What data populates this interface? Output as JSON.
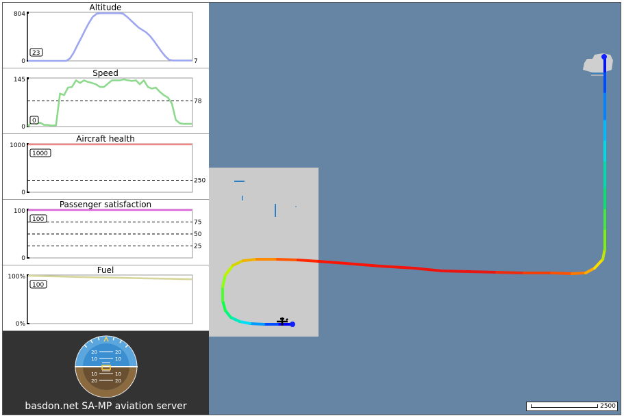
{
  "panels": [
    {
      "title": "Altitude",
      "ymax_label": "804",
      "ymin_label": "0",
      "right_label": "7",
      "badge": "23",
      "color": "#9da6f0",
      "ymax": 804,
      "refs": [],
      "values": [
        0,
        0,
        0,
        0,
        0,
        0,
        0,
        0,
        0,
        0,
        0,
        40,
        140,
        270,
        390,
        520,
        640,
        740,
        790,
        800,
        800,
        800,
        800,
        800,
        800,
        790,
        740,
        680,
        620,
        560,
        520,
        480,
        420,
        340,
        250,
        160,
        80,
        20,
        7,
        7,
        7,
        7,
        7,
        7
      ]
    },
    {
      "title": "Speed",
      "ymax_label": "145",
      "ymin_label": "0",
      "badge": "0",
      "color": "#8fd98f",
      "ymax": 145,
      "refs": [
        {
          "v": 78,
          "label": "78"
        }
      ],
      "values": [
        0,
        18,
        8,
        12,
        5,
        5,
        3,
        4,
        100,
        95,
        118,
        120,
        140,
        132,
        140,
        135,
        132,
        128,
        120,
        120,
        130,
        140,
        140,
        140,
        143,
        140,
        138,
        140,
        128,
        140,
        120,
        115,
        118,
        105,
        95,
        88,
        70,
        20,
        10,
        8,
        8,
        8
      ]
    },
    {
      "title": "Aircraft health",
      "ymax_label": "1000",
      "ymin_label": "0",
      "badge": "1000",
      "color": "#ee8888",
      "ymax": 1000,
      "refs": [
        {
          "v": 250,
          "label": "250"
        }
      ],
      "values": [
        1000,
        1000
      ]
    },
    {
      "title": "Passenger satisfaction",
      "ymax_label": "100",
      "ymin_label": "0",
      "badge": "100",
      "color": "#dd66dd",
      "ymax": 100,
      "refs": [
        {
          "v": 75,
          "label": "75"
        },
        {
          "v": 50,
          "label": "50"
        },
        {
          "v": 25,
          "label": "25"
        }
      ],
      "values": [
        100,
        100
      ]
    },
    {
      "title": "Fuel",
      "ymax_label": "100%",
      "ymin_label": "0%",
      "badge": "100",
      "color": "#d6d69a",
      "ymax": 100,
      "refs": [],
      "values": [
        100,
        99.5,
        99,
        98.5,
        98,
        97.5,
        97,
        96.6,
        96.2,
        95.8,
        95.4,
        95,
        94.6,
        94.2,
        93.8,
        93.4,
        93,
        92.6
      ]
    }
  ],
  "footer": {
    "label": "basdon.net SA-MP aviation server"
  },
  "horizon": {
    "pitch_labels": [
      "20",
      "10",
      "10",
      "20"
    ]
  },
  "map": {
    "scale_label": "2500"
  }
}
